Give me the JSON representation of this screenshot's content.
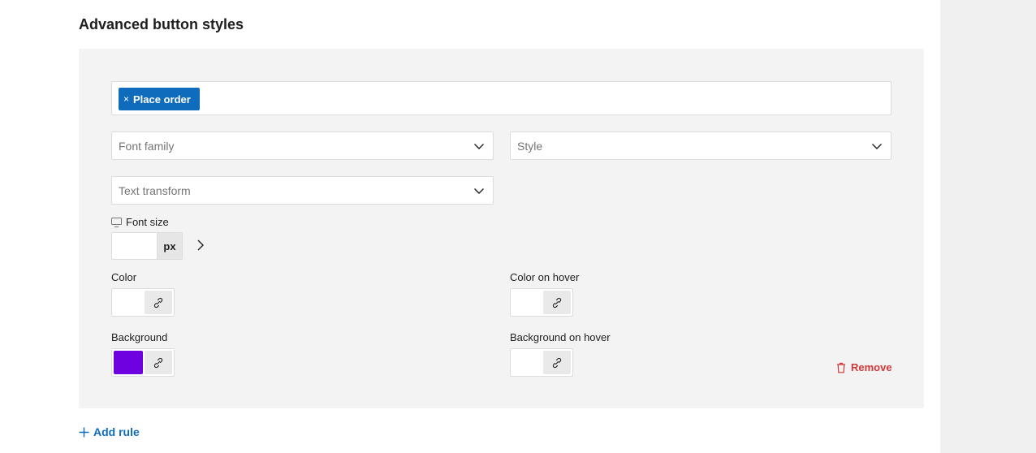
{
  "section": {
    "title": "Advanced button styles"
  },
  "rule": {
    "selected_tokens": [
      {
        "label": "Place order",
        "remove_glyph": "×"
      }
    ],
    "font_family": {
      "placeholder": "Font family"
    },
    "style": {
      "placeholder": "Style"
    },
    "text_transform": {
      "placeholder": "Text transform"
    },
    "font_size": {
      "label": "Font size",
      "value": "",
      "unit": "px",
      "device_icon": "monitor-icon"
    },
    "color": {
      "label": "Color",
      "value": ""
    },
    "color_hover": {
      "label": "Color on hover",
      "value": ""
    },
    "background": {
      "label": "Background",
      "value": "#6f00e0"
    },
    "background_hover": {
      "label": "Background on hover",
      "value": ""
    },
    "remove_label": "Remove"
  },
  "add_rule_label": "Add rule",
  "colors": {
    "accent": "#0f6cbd",
    "danger": "#d63638",
    "panel": "#f3f3f3"
  }
}
